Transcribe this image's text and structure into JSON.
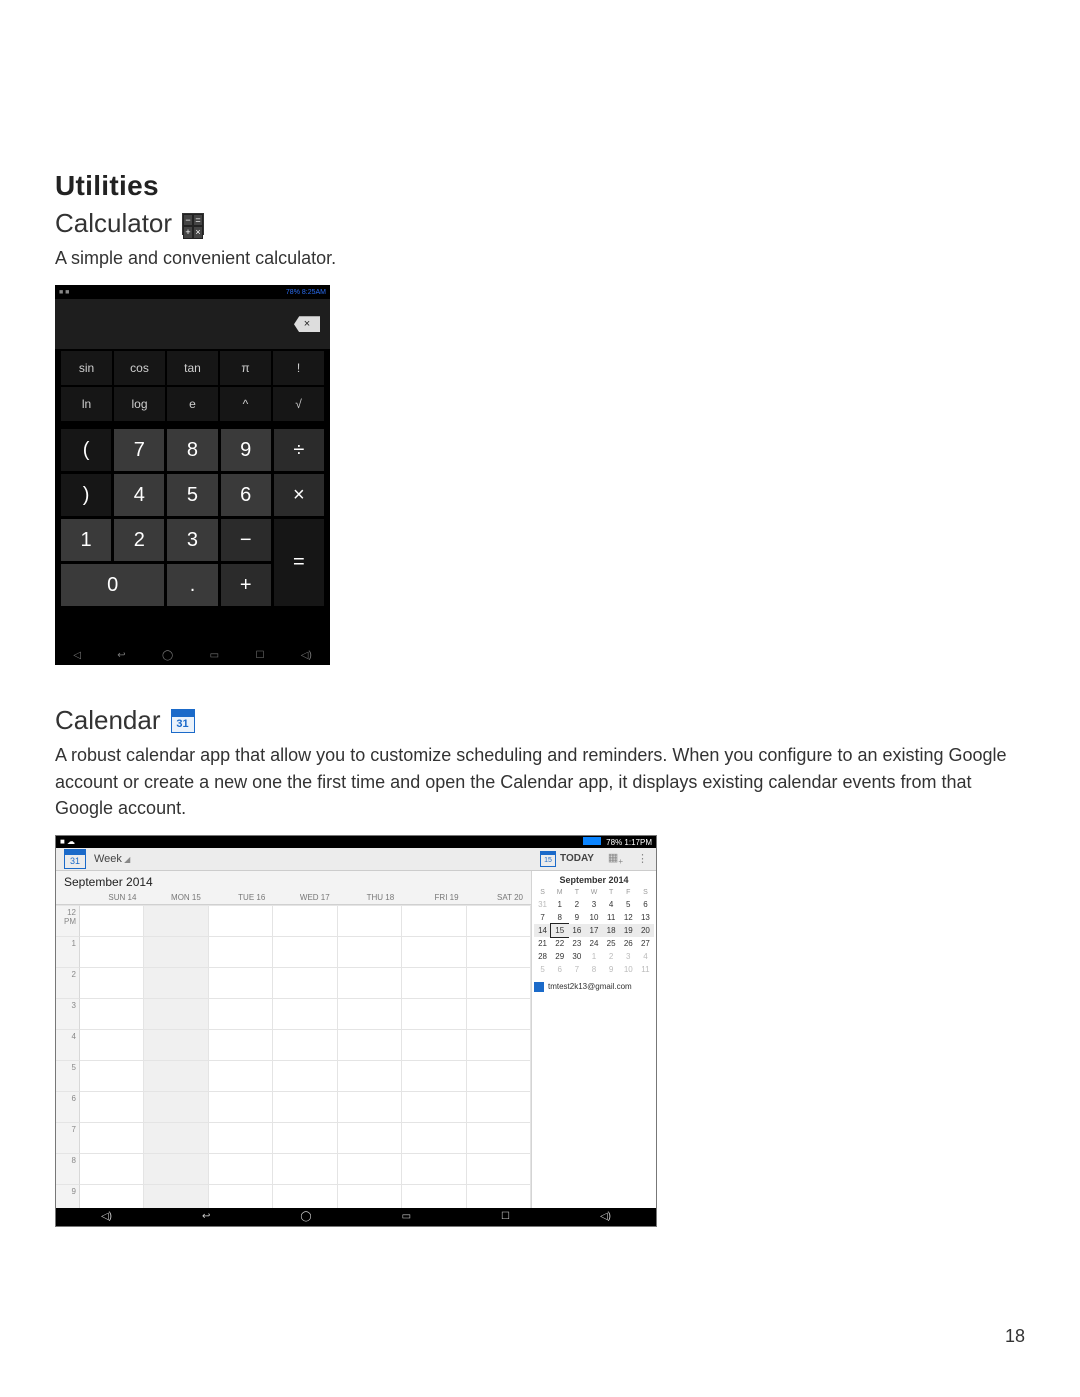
{
  "page_number": "18",
  "section_title": "Utilities",
  "calculator": {
    "title": "Calculator",
    "icon_glyphs": [
      "−",
      "=",
      "+",
      "×"
    ],
    "description": "A simple and convenient calculator.",
    "status_left": "■ ■",
    "status_right": "78% 8:25AM",
    "backspace_glyph": "×",
    "sci_keys": [
      "sin",
      "cos",
      "tan",
      "π",
      "!",
      "ln",
      "log",
      "e",
      "^",
      "√"
    ],
    "numpad": {
      "r1": [
        "7",
        "8",
        "9",
        "÷",
        "("
      ],
      "r2": [
        "4",
        "5",
        "6",
        "×",
        ")"
      ],
      "r3": [
        "1",
        "2",
        "3",
        "−"
      ],
      "r4_zero": "0",
      "r4_dot": ".",
      "r4_plus": "+",
      "eq": "="
    },
    "nav_glyphs": [
      "◁",
      "↩",
      "◯",
      "▭",
      "☐",
      "◁)"
    ]
  },
  "calendar": {
    "title": "Calendar",
    "icon_day": "31",
    "description": "A robust calendar app that allow you to customize scheduling and reminders. When you configure to an existing Google account or create a new one the first time and open the Calendar app, it displays existing calendar events from that Google account.",
    "status_left": "■ ☁",
    "status_battery": "78%",
    "status_time": "1:17PM",
    "toolbar": {
      "icon_day": "31",
      "view_label": "Week",
      "today_icon_day": "15",
      "today_label": "TODAY"
    },
    "month_label": "September 2014",
    "day_headers": [
      "SUN 14",
      "MON 15",
      "TUE 16",
      "WED 17",
      "THU 18",
      "FRI 19",
      "SAT 20"
    ],
    "hours": [
      "12 PM",
      "1",
      "2",
      "3",
      "4",
      "5",
      "6",
      "7",
      "8",
      "9"
    ],
    "today_col": 1,
    "mini": {
      "title": "September 2014",
      "dow": [
        "S",
        "M",
        "T",
        "W",
        "T",
        "F",
        "S"
      ],
      "rows": [
        [
          "31",
          "1",
          "2",
          "3",
          "4",
          "5",
          "6"
        ],
        [
          "7",
          "8",
          "9",
          "10",
          "11",
          "12",
          "13"
        ],
        [
          "14",
          "15",
          "16",
          "17",
          "18",
          "19",
          "20"
        ],
        [
          "21",
          "22",
          "23",
          "24",
          "25",
          "26",
          "27"
        ],
        [
          "28",
          "29",
          "30",
          "1",
          "2",
          "3",
          "4"
        ],
        [
          "5",
          "6",
          "7",
          "8",
          "9",
          "10",
          "11"
        ]
      ],
      "today": "15",
      "current_week_row": 2,
      "account": "tmtest2k13@gmail.com"
    },
    "nav_glyphs": [
      "◁)",
      "↩",
      "◯",
      "▭",
      "☐",
      "◁)"
    ]
  }
}
